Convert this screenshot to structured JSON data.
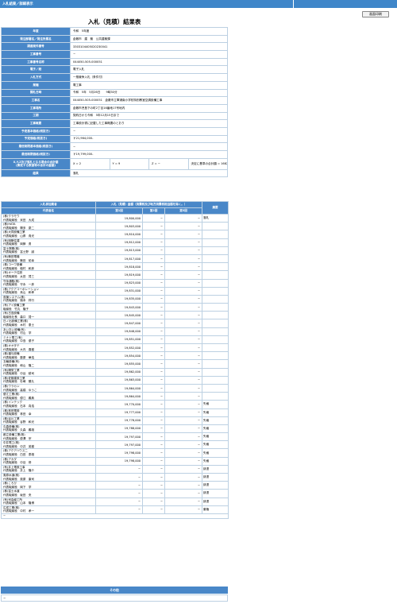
{
  "topbar": {
    "breadcrumb": "入札結果／詳細表示"
  },
  "print_button": "画面印刷",
  "title": "入札（見積）結果表",
  "summary": [
    {
      "label": "年度",
      "value": "令和　5年度"
    },
    {
      "label": "発注部署名／発注所属名",
      "value": "倉敷市　建　築　公共建築課"
    },
    {
      "label": "調達案件番号",
      "value": "3303104405020230041"
    },
    {
      "label": "工事番号",
      "value": "−"
    },
    {
      "label": "工事番号名称",
      "value": "044050-505-000051"
    },
    {
      "label": "電子／紙",
      "value": "電子入札"
    },
    {
      "label": "入札方式",
      "value": "一般競争入札（条件付）"
    },
    {
      "label": "業種",
      "value": "電工事"
    },
    {
      "label": "開札日時",
      "value": "令和　5年　5月26日　　9時30分"
    },
    {
      "label": "工事名",
      "value": "044050-505-000051　倉敷市立軍浦南小学校特別教室空調設備工事"
    },
    {
      "label": "工事場所",
      "value": "倉敷市児島下の町2丁目16番地17号地内"
    },
    {
      "label": "工期",
      "value": "契約日から令和　5年12月15日まで"
    },
    {
      "label": "工事概要",
      "value": "工事設計書に記載した工事概要のとおり"
    },
    {
      "label": "予定基本価格(税抜き)",
      "value": "−"
    },
    {
      "label": "予定価格(税抜き)",
      "value": "￥21,964,000-"
    },
    {
      "label": "最低制限基本価格(税抜き)",
      "value": "−"
    },
    {
      "label": "最低制限価格(税抜き)",
      "value": "￥19,799,000-"
    }
  ],
  "score_row": {
    "label_line1": "X,Y,Z及び落札となる場合の合計額",
    "label_line2": "(算定する数値等の合計の金額)",
    "x": "X = 2",
    "y": "Y = 9",
    "z": "Z = −",
    "total": "決定に基準の合計額 = 16829"
  },
  "result": {
    "label": "結果",
    "value": "落札"
  },
  "bid_table": {
    "head_bidder": "入札参加業者",
    "head_amount": "入札（見積）金額（消費税及び地方消費税相当額を除く。）",
    "head_remark": "摘要",
    "head_name": "代表者名",
    "head_round1": "第1回",
    "head_round2": "第2回",
    "head_round3": "第3回"
  },
  "bidders": [
    {
      "company": "(株)クラモウ",
      "rep": "代表取締役　米田　大成",
      "amount": "19,800,000",
      "remark": "落札"
    },
    {
      "company": "(株)HATA",
      "rep": "代表取締役　陽多　慶二",
      "amount": "19,803,000",
      "remark": ""
    },
    {
      "company": "(株)大同設備工業",
      "rep": "代表取締役　山県　貴光",
      "amount": "19,810,000",
      "remark": ""
    },
    {
      "company": "(有)岡節住建",
      "rep": "代表取締役　岡節　勇",
      "amount": "19,812,000",
      "remark": ""
    },
    {
      "company": "富士興業(株)",
      "rep": "代表取締役　富士野　誠",
      "amount": "19,813,000",
      "remark": ""
    },
    {
      "company": "(有)磐田電機",
      "rep": "代表取締役　磐田　祐幸",
      "amount": "19,817,000",
      "remark": ""
    },
    {
      "company": "(株)コーワ設備",
      "rep": "代表取締役　稲村　和彦",
      "amount": "19,818,000",
      "remark": ""
    },
    {
      "company": "(有)オーテ住設",
      "rep": "代表取締役　太田　賢三",
      "amount": "19,819,000",
      "remark": ""
    },
    {
      "company": "守永通販(株)",
      "rep": "代表取締役　守永　一彦",
      "amount": "19,823,000",
      "remark": ""
    },
    {
      "company": "(株)アクアコーポレーション",
      "rep": "代表取締役　烏山　和孝",
      "amount": "19,831,000",
      "remark": ""
    },
    {
      "company": "皮膜システム(株)",
      "rep": "代表取締役　鎮本　祥行",
      "amount": "19,835,000",
      "remark": ""
    },
    {
      "company": "(有)アイ設備工業",
      "rep": "取締役　竹丸　隆子",
      "amount": "19,843,000",
      "remark": ""
    },
    {
      "company": "(有)古島設備",
      "rep": "取締役社長　森口　賢一",
      "amount": "19,845,000",
      "remark": ""
    },
    {
      "company": "日ノ出設備工業(株)",
      "rep": "代表取締役　木村　恵士",
      "amount": "19,847,000",
      "remark": ""
    },
    {
      "company": "あいおい設備(有)",
      "rep": "代表取締役　村山　学",
      "amount": "19,848,000",
      "remark": ""
    },
    {
      "company": "ミナト電工(有)",
      "rep": "代表取締役　中島　優子",
      "amount": "19,851,000",
      "remark": ""
    },
    {
      "company": "(株)オオタテ",
      "rep": "代表取締役　大内　喜樹",
      "amount": "19,852,000",
      "remark": ""
    },
    {
      "company": "(株)福与設備",
      "rep": "代表取締役　藤原　華浩",
      "amount": "19,854,000",
      "remark": ""
    },
    {
      "company": "五輪設備(有)",
      "rep": "代表取締役　和山　隆二",
      "amount": "19,855,000",
      "remark": ""
    },
    {
      "company": "(有)陽栄工業",
      "rep": "代表取締役　中谷　耕司",
      "amount": "19,862,000",
      "remark": ""
    },
    {
      "company": "(株)佐藤建設工業",
      "rep": "代表取締役　杉﨑　勝久",
      "amount": "19,863,000",
      "remark": ""
    },
    {
      "company": "(株)ウラカン",
      "rep": "代表取締役　高橋　ゆうこ",
      "amount": "19,864,000",
      "remark": ""
    },
    {
      "company": "優江工業(株)",
      "rep": "代表取締役　優江　義典",
      "amount": "19,864,000",
      "remark": ""
    },
    {
      "company": "(株)インテック",
      "rep": "代表取締役　石本　真浩",
      "amount": "19,770,000",
      "remark": "失格"
    },
    {
      "company": "(株)林田電設",
      "rep": "代表取締役　林田　幸",
      "amount": "19,777,000",
      "remark": "失格"
    },
    {
      "company": "(株)谷川工業",
      "rep": "代表取締役　谷野　和光",
      "amount": "19,778,000",
      "remark": "失格"
    },
    {
      "company": "久森設備(株)",
      "rep": "代表取締役　久森　義雄",
      "amount": "19,788,000",
      "remark": "失格"
    },
    {
      "company": "都立設備工業(株)",
      "rep": "代表取締役　原澤　宗",
      "amount": "19,797,000",
      "remark": "失格"
    },
    {
      "company": "中井電工(株)",
      "rep": "代表取締役　中井　英樹",
      "amount": "19,797,000",
      "remark": "失格"
    },
    {
      "company": "(株)アクアハウス二",
      "rep": "代表取締役　白田　泰雄",
      "amount": "19,798,000",
      "remark": "失格"
    },
    {
      "company": "(株)アカダ",
      "rep": "代表取締役　中目　修",
      "amount": "19,798,000",
      "remark": "失格"
    },
    {
      "company": "(有)井上電設工事",
      "rep": "代表取締役　井上　隆介",
      "amount": "−",
      "remark": "辞退"
    },
    {
      "company": "奥原水道(株)",
      "rep": "代表取締役　奥原　康司",
      "amount": "−",
      "remark": "辞退"
    },
    {
      "company": "(株)ころび",
      "rep": "代表取締役　岡下　学",
      "amount": "−",
      "remark": "辞退"
    },
    {
      "company": "(株)富士水道",
      "rep": "代表取締役　坂田　央",
      "amount": "−",
      "remark": "辞退"
    },
    {
      "company": "(有)司会締工所",
      "rep": "代表取締役　山本　隆博",
      "amount": "−",
      "remark": "辞退"
    },
    {
      "company": "広成工業(株)",
      "rep": "代表取締役　中村　孝一",
      "amount": "−",
      "remark": "棄権"
    }
  ],
  "dash": "−",
  "other": {
    "head": "その他",
    "value": "−"
  }
}
